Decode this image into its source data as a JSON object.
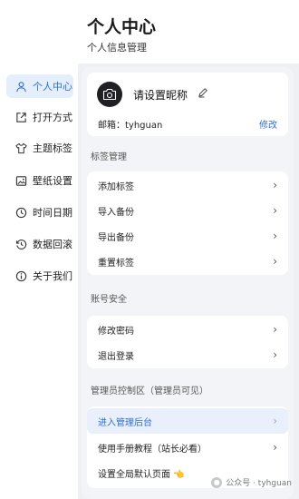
{
  "header": {
    "title": "个人中心",
    "subtitle": "个人信息管理"
  },
  "sidebar": {
    "items": [
      {
        "label": "个人中心",
        "icon": "user-icon",
        "active": true
      },
      {
        "label": "打开方式",
        "icon": "external-link-icon"
      },
      {
        "label": "主题标签",
        "icon": "shirt-icon"
      },
      {
        "label": "壁纸设置",
        "icon": "image-icon"
      },
      {
        "label": "时间日期",
        "icon": "clock-icon"
      },
      {
        "label": "数据回滚",
        "icon": "history-icon"
      },
      {
        "label": "关于我们",
        "icon": "info-icon"
      }
    ]
  },
  "profile": {
    "nickname": "请设置昵称",
    "email": "邮箱：tyhguan",
    "edit_label": "修改"
  },
  "tag_section": {
    "title": "标签管理",
    "items": [
      "添加标签",
      "导入备份",
      "导出备份",
      "重置标签"
    ]
  },
  "account_section": {
    "title": "账号安全",
    "items": [
      "修改密码",
      "退出登录"
    ]
  },
  "admin_section": {
    "title": "管理员控制区（管理员可见）",
    "items": [
      "进入管理后台",
      "使用手册教程（站长必看）",
      "设置全局默认页面 👈"
    ]
  },
  "footer": {
    "text": "公众号 · tyhguan"
  },
  "colors": {
    "accent": "#2f6fd6",
    "active_bg": "#e5eefb",
    "background": "#eef0f4"
  }
}
